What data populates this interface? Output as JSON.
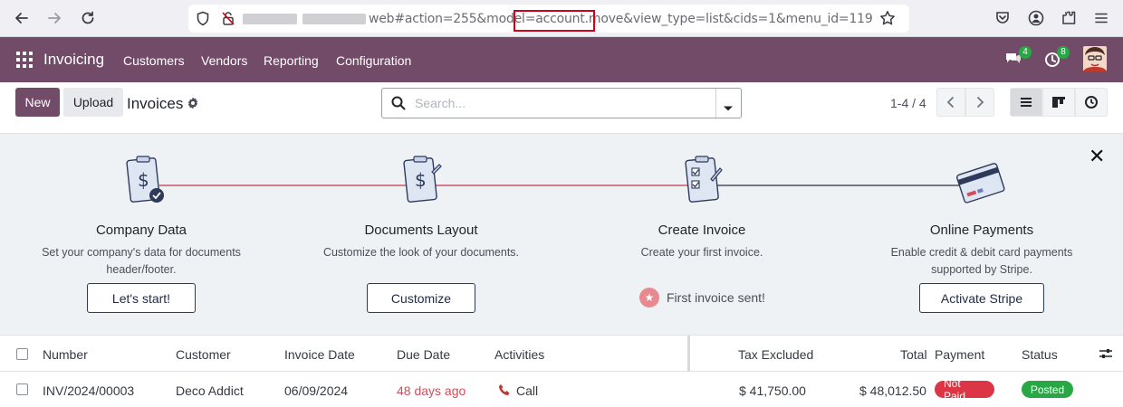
{
  "browser": {
    "url": "web#action=255&model=account.move&view_type=list&cids=1&menu_id=119"
  },
  "navbar": {
    "app_name": "Invoicing",
    "menu": [
      "Customers",
      "Vendors",
      "Reporting",
      "Configuration"
    ],
    "messages_count": "4",
    "activities_count": "8"
  },
  "control": {
    "new_label": "New",
    "upload_label": "Upload",
    "title": "Invoices",
    "search_placeholder": "Search...",
    "pager": "1-4 / 4"
  },
  "onboarding": {
    "steps": [
      {
        "title": "Company Data",
        "desc1": "Set your company's data for documents",
        "desc2": "header/footer.",
        "button": "Let's start!"
      },
      {
        "title": "Documents Layout",
        "desc1": "Customize the look of your documents.",
        "desc2": "",
        "button": "Customize"
      },
      {
        "title": "Create Invoice",
        "desc1": "Create your first invoice.",
        "desc2": "",
        "done": "First invoice sent!"
      },
      {
        "title": "Online Payments",
        "desc1": "Enable credit & debit card payments",
        "desc2": "supported by Stripe.",
        "button": "Activate Stripe"
      }
    ]
  },
  "table": {
    "headers": [
      "Number",
      "Customer",
      "Invoice Date",
      "Due Date",
      "Activities",
      "Tax Excluded",
      "Total",
      "Payment",
      "Status"
    ],
    "rows": [
      {
        "number": "INV/2024/00003",
        "customer": "Deco Addict",
        "invoice_date": "06/09/2024",
        "due_date": "48 days ago",
        "activity": "Call",
        "tax_excluded": "$ 41,750.00",
        "total": "$ 48,012.50",
        "payment": "Not Paid",
        "status": "Posted"
      }
    ]
  },
  "colors": {
    "brand": "#714b67",
    "not_paid": "#dc3545",
    "posted": "#28a745"
  }
}
